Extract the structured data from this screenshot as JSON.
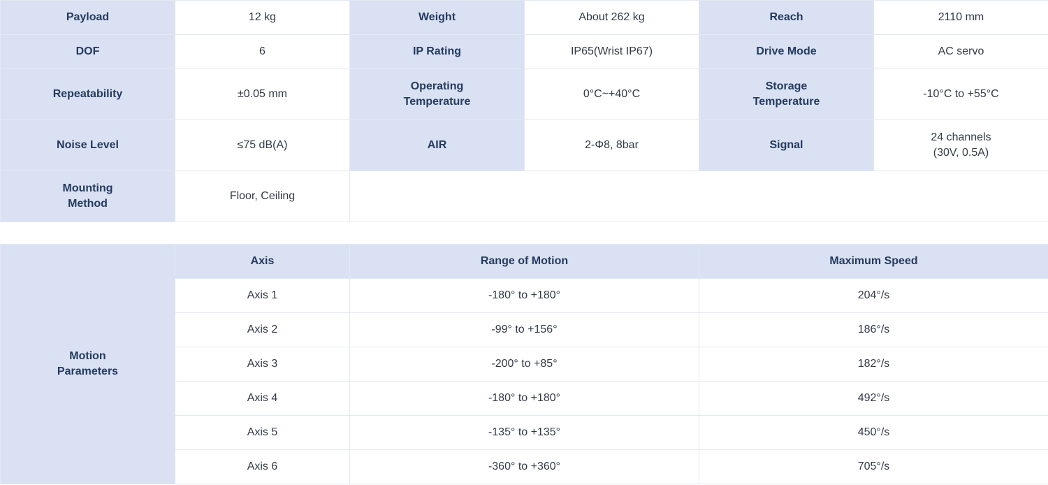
{
  "specs": {
    "rows": [
      [
        {
          "label": "Payload",
          "value": "12 kg"
        },
        {
          "label": "Weight",
          "value": "About 262 kg"
        },
        {
          "label": "Reach",
          "value": "2110 mm"
        }
      ],
      [
        {
          "label": "DOF",
          "value": "6"
        },
        {
          "label": "IP Rating",
          "value": "IP65(Wrist IP67)"
        },
        {
          "label": "Drive Mode",
          "value": "AC servo"
        }
      ],
      [
        {
          "label": "Repeatability",
          "value": "±0.05 mm"
        },
        {
          "label": "Operating\nTemperature",
          "value": "0°C~+40°C"
        },
        {
          "label": "Storage\nTemperature",
          "value": "-10°C to +55°C"
        }
      ],
      [
        {
          "label": "Noise Level",
          "value": "≤75 dB(A)"
        },
        {
          "label": "AIR",
          "value": "2-Φ8, 8bar"
        },
        {
          "label": "Signal",
          "value": "24 channels\n(30V, 0.5A)"
        }
      ],
      [
        {
          "label": "Mounting\nMethod",
          "value": "Floor, Ceiling"
        }
      ]
    ]
  },
  "motion": {
    "label": "Motion\nParameters",
    "headers": [
      "Axis",
      "Range of Motion",
      "Maximum Speed"
    ],
    "rows": [
      [
        "Axis 1",
        "-180° to +180°",
        "204°/s"
      ],
      [
        "Axis 2",
        "-99° to +156°",
        "186°/s"
      ],
      [
        "Axis 3",
        "-200° to +85°",
        "182°/s"
      ],
      [
        "Axis 4",
        "-180° to +180°",
        "492°/s"
      ],
      [
        "Axis 5",
        "-135° to +135°",
        "450°/s"
      ],
      [
        "Axis 6",
        "-360° to +360°",
        "705°/s"
      ]
    ]
  }
}
